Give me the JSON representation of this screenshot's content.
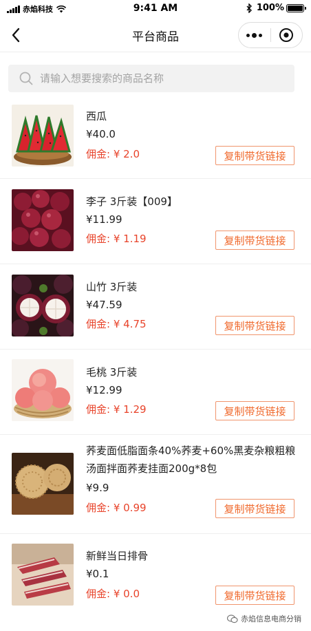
{
  "status_bar": {
    "carrier": "赤焰科技",
    "time": "9:41 AM",
    "battery": "100%"
  },
  "nav": {
    "title": "平台商品",
    "back_icon": "chevron-left-icon",
    "more_icon": "more-dots-icon",
    "close_icon": "target-close-icon"
  },
  "search": {
    "placeholder": "请输入想要搜索的商品名称",
    "value": "",
    "icon": "search-icon"
  },
  "products": [
    {
      "name": "西瓜",
      "price": "¥40.0",
      "commission": "佣金: ¥ 2.0",
      "button": "复制带货链接",
      "image": "watermelon"
    },
    {
      "name": "李子 3斤装【009】",
      "price": "¥11.99",
      "commission": "佣金: ¥ 1.19",
      "button": "复制带货链接",
      "image": "plums"
    },
    {
      "name": "山竹 3斤装",
      "price": "¥47.59",
      "commission": "佣金: ¥ 4.75",
      "button": "复制带货链接",
      "image": "mangosteen"
    },
    {
      "name": "毛桃 3斤装",
      "price": "¥12.99",
      "commission": "佣金: ¥ 1.29",
      "button": "复制带货链接",
      "image": "peaches"
    },
    {
      "name": "荞麦面低脂面条40%荞麦+60%黑麦杂粮粗粮汤面拌面荞麦挂面200g*8包",
      "price": "¥9.9",
      "commission": "佣金: ¥ 0.99",
      "button": "复制带货链接",
      "image": "noodles"
    },
    {
      "name": "新鲜当日排骨",
      "price": "¥0.1",
      "commission": "佣金: ¥ 0.0",
      "button": "复制带货链接",
      "image": "ribs"
    }
  ],
  "watermark": "赤焰信息电商分销",
  "colors": {
    "commission": "#e8432a",
    "button_border": "#f0946c",
    "button_text": "#f06a2e",
    "search_bg": "#f2f2f2"
  }
}
